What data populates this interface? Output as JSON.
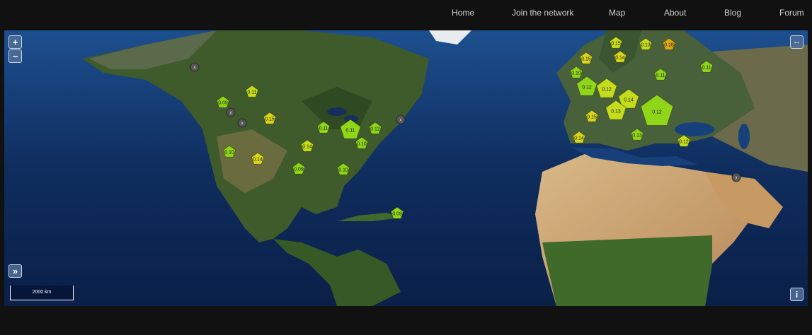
{
  "nav": {
    "items": [
      {
        "label": "Home"
      },
      {
        "label": "Join the network"
      },
      {
        "label": "Map"
      },
      {
        "label": "About"
      },
      {
        "label": "Blog"
      },
      {
        "label": "Forum"
      }
    ]
  },
  "map": {
    "scale_label": "2000 km",
    "controls": {
      "zoom_in": "+",
      "zoom_out": "−",
      "expand": "»",
      "info": "i",
      "fullwidth": "↔"
    },
    "colors": {
      "green": "#8fd61b",
      "yellow_green": "#c4dc1c",
      "yellow": "#d9d41c",
      "orange": "#e0a814",
      "offline": "#555555"
    },
    "markers": [
      {
        "label": "0.15",
        "color": "yellow_green",
        "size": "small"
      },
      {
        "label": "0.13",
        "color": "yellow_green",
        "size": "small"
      },
      {
        "label": "0.18",
        "color": "orange",
        "size": "small"
      },
      {
        "label": "0.15",
        "color": "yellow",
        "size": "small"
      },
      {
        "label": "0.14",
        "color": "yellow",
        "size": "small"
      },
      {
        "label": "0.11",
        "color": "green",
        "size": "small"
      },
      {
        "label": "0.10",
        "color": "green",
        "size": "small"
      },
      {
        "label": "0.11",
        "color": "green",
        "size": "small"
      },
      {
        "label": "0.12",
        "color": "green",
        "size": "medium"
      },
      {
        "label": "0.12",
        "color": "yellow_green",
        "size": "medium"
      },
      {
        "label": "0.14",
        "color": "yellow_green",
        "size": "medium"
      },
      {
        "label": "0.13",
        "color": "yellow_green",
        "size": "medium"
      },
      {
        "label": "0.12",
        "color": "green",
        "size": "large"
      },
      {
        "label": "0.15",
        "color": "yellow",
        "size": "small"
      },
      {
        "label": "0.13",
        "color": "green",
        "size": "small"
      },
      {
        "label": "0.14",
        "color": "yellow",
        "size": "small"
      },
      {
        "label": "0.12",
        "color": "yellow_green",
        "size": "small"
      },
      {
        "label": "0.11",
        "color": "yellow_green",
        "size": "small"
      },
      {
        "label": "0.09",
        "color": "green",
        "size": "small"
      },
      {
        "label": "0.15",
        "color": "yellow",
        "size": "small"
      },
      {
        "label": "0.11",
        "color": "green",
        "size": "small"
      },
      {
        "label": "0.11",
        "color": "green",
        "size": "medium"
      },
      {
        "label": "0.12",
        "color": "green",
        "size": "small"
      },
      {
        "label": "0.10",
        "color": "green",
        "size": "small"
      },
      {
        "label": "0.14",
        "color": "yellow_green",
        "size": "small"
      },
      {
        "label": "0.10",
        "color": "green",
        "size": "small"
      },
      {
        "label": "0.14",
        "color": "yellow",
        "size": "small"
      },
      {
        "label": "0.09",
        "color": "green",
        "size": "small"
      },
      {
        "label": "0.10",
        "color": "green",
        "size": "small"
      },
      {
        "label": "0.09",
        "color": "green",
        "size": "small"
      }
    ],
    "offline_nodes": [
      {
        "label": "x"
      },
      {
        "label": "x"
      },
      {
        "label": "x"
      },
      {
        "label": "x"
      },
      {
        "label": "x"
      }
    ]
  }
}
